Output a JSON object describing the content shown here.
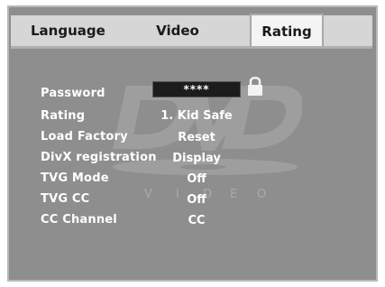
{
  "tabs": [
    {
      "label": "Language"
    },
    {
      "label": "Video"
    },
    {
      "label": "Rating"
    }
  ],
  "active_tab": "Rating",
  "settings": [
    {
      "label": "Password",
      "value": "****"
    },
    {
      "label": "Rating",
      "value": "1. Kid Safe"
    },
    {
      "label": "Load Factory",
      "value": "Reset"
    },
    {
      "label": "DivX registration",
      "value": "Display"
    },
    {
      "label": "TVG Mode",
      "value": "Off"
    },
    {
      "label": "TVG CC",
      "value": "Off"
    },
    {
      "label": "CC Channel",
      "value": "CC"
    }
  ],
  "logo": {
    "text": "DVD",
    "subtext": "VIDEO"
  },
  "colors": {
    "background": "#8e8e8e",
    "tabbar": "#d6d6d6",
    "active_tab": "#f4f4f4",
    "text": "#ffffff"
  },
  "icons": {
    "lock": "lock-icon"
  }
}
